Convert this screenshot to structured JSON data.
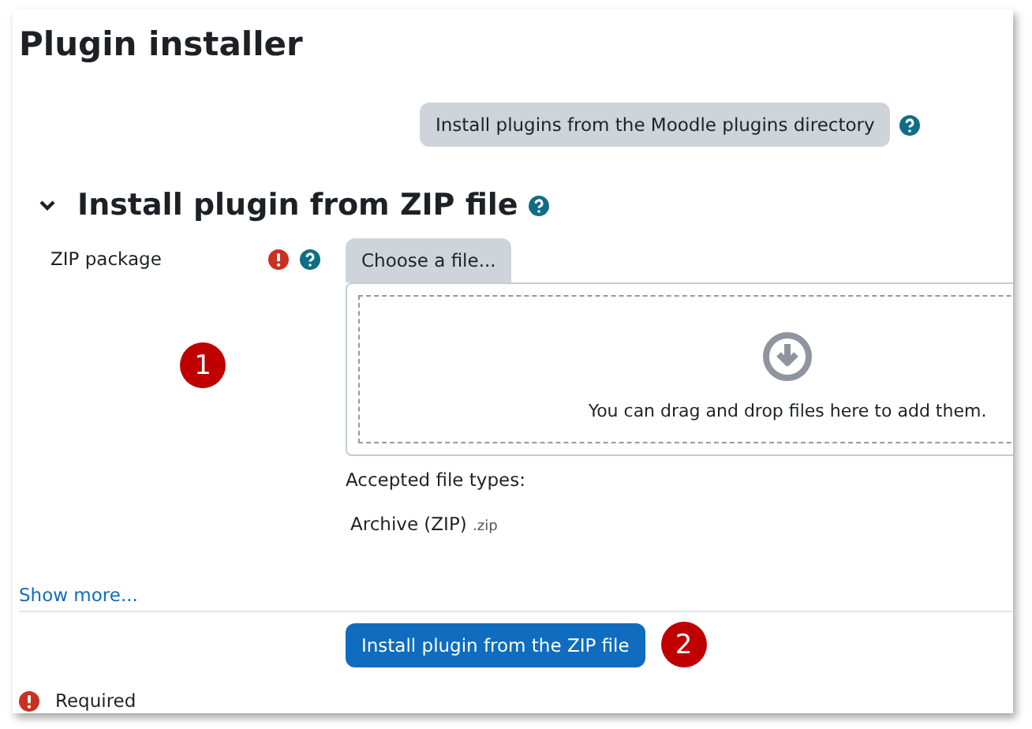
{
  "page_title": "Plugin installer",
  "directory_button": {
    "label": "Install plugins from the Moodle plugins directory"
  },
  "section": {
    "title": "Install plugin from ZIP file",
    "expanded": true
  },
  "zip_field": {
    "label": "ZIP package",
    "required": true,
    "choose_button": "Choose a file...",
    "drop_hint": "You can drag and drop files here to add them.",
    "accepted_label": "Accepted file types:",
    "accepted_types": [
      {
        "name": "Archive (ZIP)",
        "extension": ".zip"
      }
    ]
  },
  "show_more": "Show more...",
  "submit_button": "Install plugin from the ZIP file",
  "callouts": [
    "1",
    "2"
  ],
  "required_note": "Required"
}
